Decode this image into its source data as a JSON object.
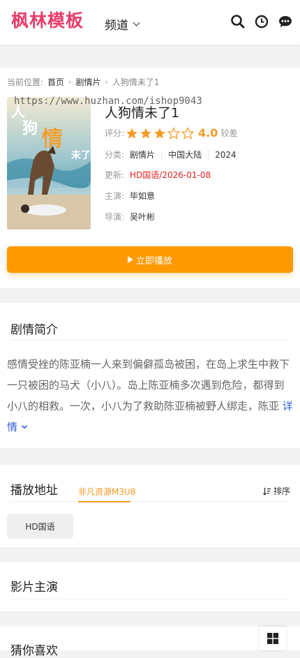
{
  "header": {
    "logo": "枫林模板",
    "channel_label": "频道",
    "icons": [
      "search-icon",
      "history-icon",
      "message-icon"
    ]
  },
  "detail": {
    "breadcrumb": {
      "prefix": "当前位置:",
      "home": "首页",
      "category": "剧情片",
      "current": "人狗情未了1"
    },
    "watermark": "https://www.huzhan.com/ishop9043",
    "title": "人狗情未了1",
    "rating": {
      "label": "评分:",
      "stars": 3,
      "max_stars": 5,
      "score": "4.0",
      "desc": "较差"
    },
    "category": {
      "label": "分类:",
      "values": [
        "剧情片",
        "中国大陆",
        "2024"
      ]
    },
    "update": {
      "label": "更新:",
      "value": "HD国语/2026-01-08"
    },
    "cast": {
      "label": "主演:",
      "value": "毕如意"
    },
    "director": {
      "label": "导演:",
      "value": "吴叶彬"
    },
    "play_button": "立即播放"
  },
  "synopsis": {
    "title": "剧情简介",
    "text": "感情受挫的陈亚楠一人来到偏僻孤岛被困，在岛上求生中救下一只被困的马犬（小八）。岛上陈亚楠多次遇到危险，都得到小八的相救。一次，小八为了救助陈亚楠被野人绑走，陈亚 ",
    "more": "详情"
  },
  "play_source": {
    "title": "播放地址",
    "source_tab": "非凡资源M3U8",
    "sort_label": "排序",
    "episodes": [
      "HD国语"
    ]
  },
  "cast_section": {
    "title": "影片主演"
  },
  "recommend": {
    "title": "猜你喜欢"
  },
  "colors": {
    "logo": "#e83e6b",
    "accent": "#ff9900",
    "star": "#f59a23",
    "link": "#2d5dd8",
    "update": "#e02020"
  }
}
